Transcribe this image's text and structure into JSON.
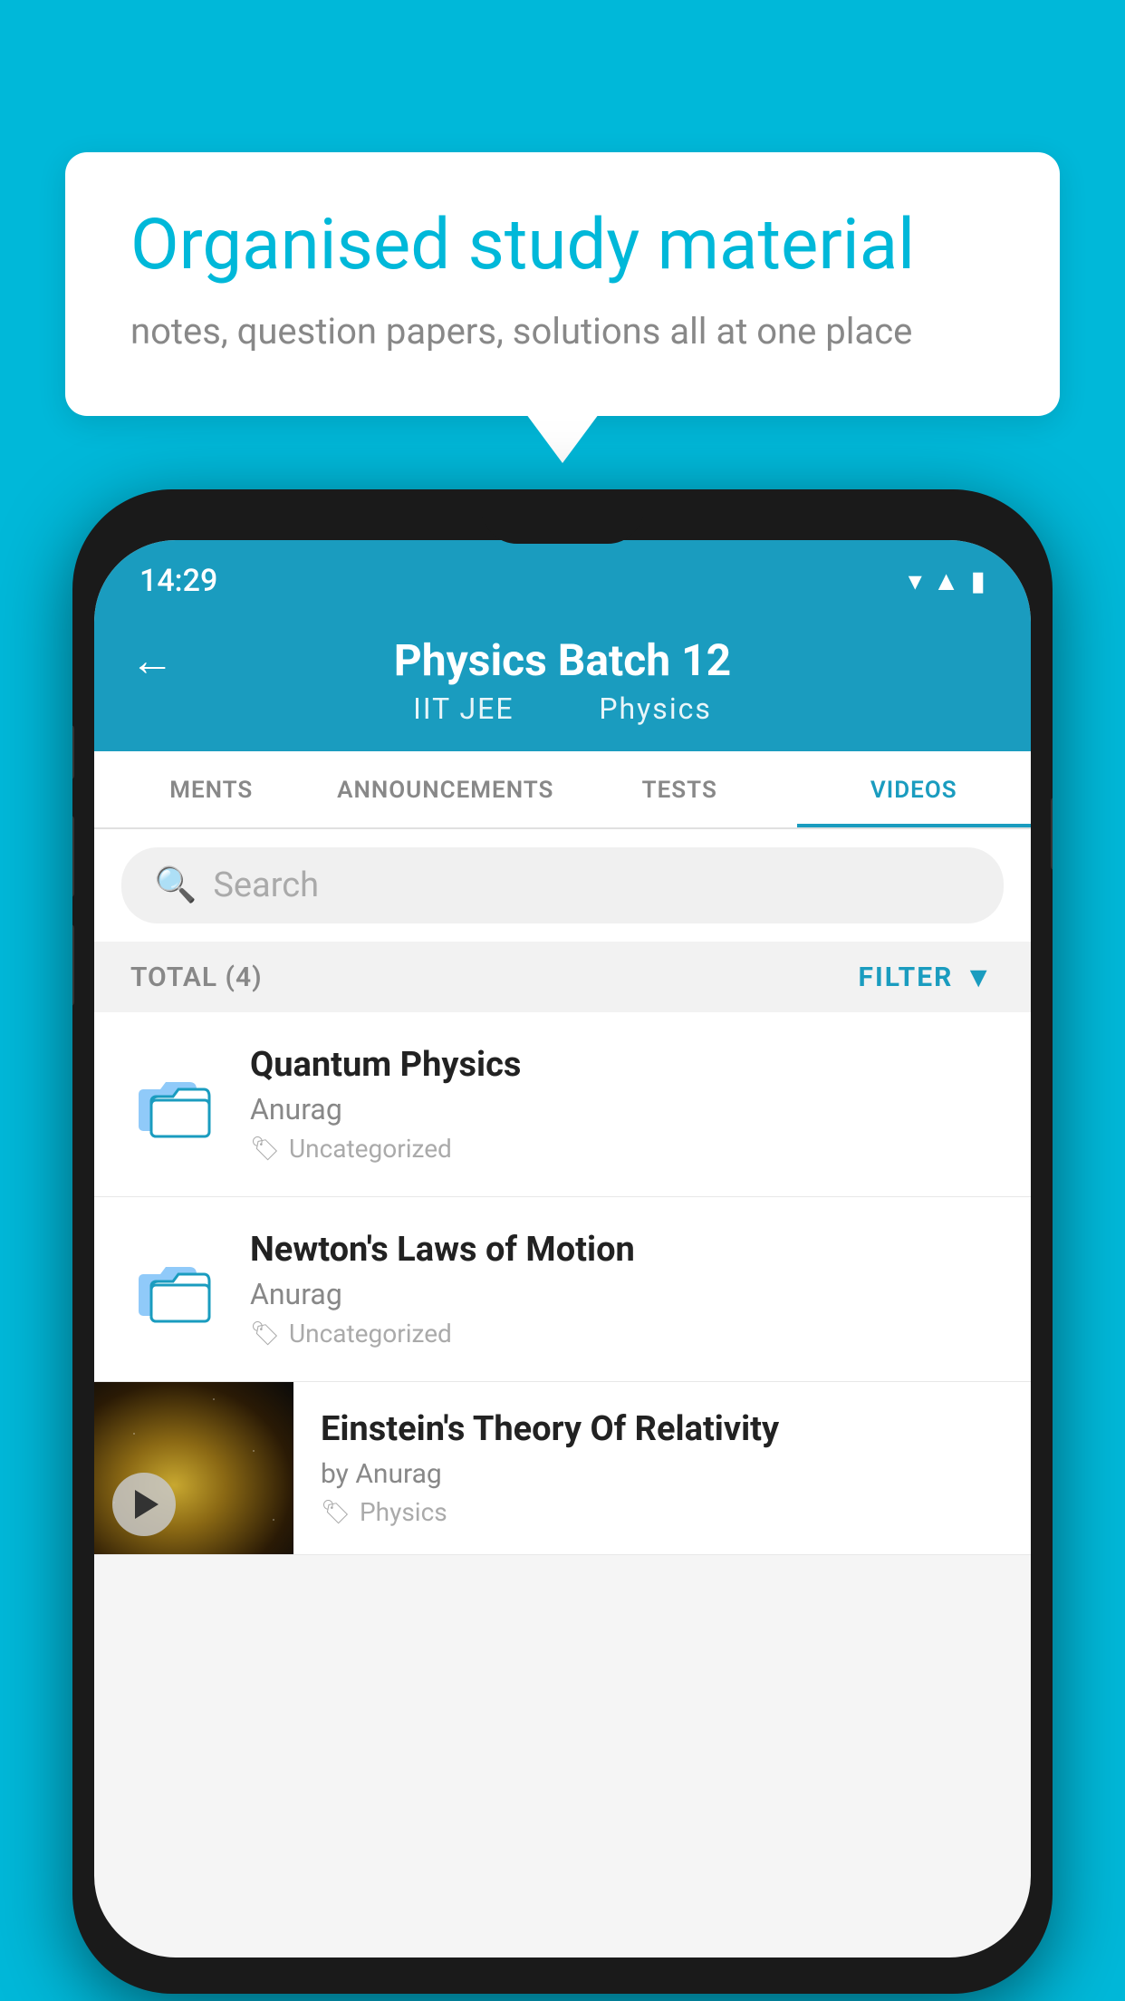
{
  "background_color": "#00B8D9",
  "speech_bubble": {
    "title": "Organised study material",
    "subtitle": "notes, question papers, solutions all at one place"
  },
  "phone": {
    "status_bar": {
      "time": "14:29"
    },
    "header": {
      "title": "Physics Batch 12",
      "subtitle_left": "IIT JEE",
      "subtitle_right": "Physics",
      "back_label": "←"
    },
    "tabs": [
      {
        "label": "MENTS",
        "active": false
      },
      {
        "label": "ANNOUNCEMENTS",
        "active": false
      },
      {
        "label": "TESTS",
        "active": false
      },
      {
        "label": "VIDEOS",
        "active": true
      }
    ],
    "search": {
      "placeholder": "Search"
    },
    "filter_bar": {
      "total_label": "TOTAL (4)",
      "filter_label": "FILTER"
    },
    "videos": [
      {
        "title": "Quantum Physics",
        "author": "Anurag",
        "tag": "Uncategorized",
        "has_thumb": false
      },
      {
        "title": "Newton's Laws of Motion",
        "author": "Anurag",
        "tag": "Uncategorized",
        "has_thumb": false
      },
      {
        "title": "Einstein's Theory Of Relativity",
        "author": "by Anurag",
        "tag": "Physics",
        "has_thumb": true
      }
    ]
  }
}
